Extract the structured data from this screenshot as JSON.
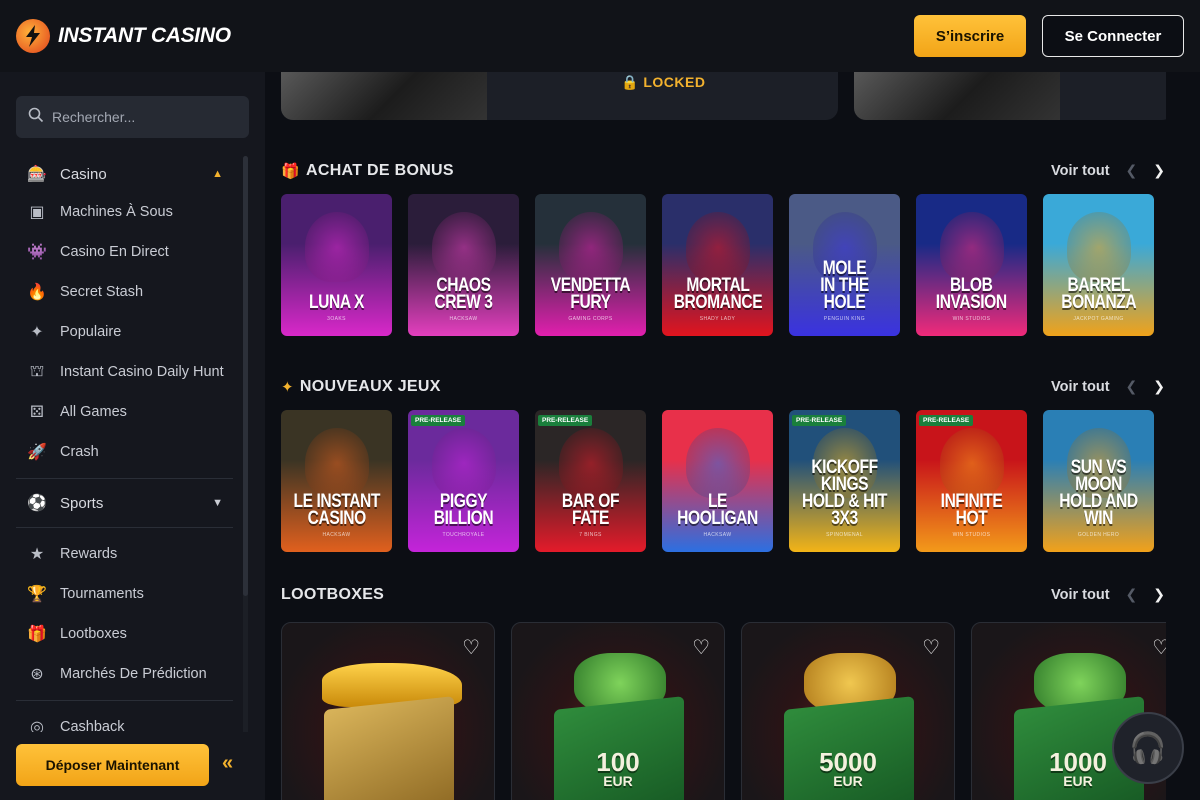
{
  "header": {
    "logo_text": "INSTANT CASINO",
    "signup_label": "S’inscrire",
    "login_label": "Se Connecter"
  },
  "sidebar": {
    "search_placeholder": "Rechercher...",
    "casino_label": "Casino",
    "items": [
      {
        "label": "Machines À Sous",
        "icon": "slot-machine-icon"
      },
      {
        "label": "Casino En Direct",
        "icon": "live-invader-icon"
      },
      {
        "label": "Secret Stash",
        "icon": "flame-icon"
      },
      {
        "label": "Populaire",
        "icon": "sparkle-icon"
      },
      {
        "label": "Instant Casino Daily Hunt",
        "icon": "daily-hunt-icon"
      },
      {
        "label": "All Games",
        "icon": "all-games-icon"
      },
      {
        "label": "Crash",
        "icon": "rocket-icon"
      }
    ],
    "sports_label": "Sports",
    "items2": [
      {
        "label": "Rewards",
        "icon": "star-icon"
      },
      {
        "label": "Tournaments",
        "icon": "trophy-icon"
      },
      {
        "label": "Lootboxes",
        "icon": "gift-icon"
      },
      {
        "label": "Marchés De Prédiction",
        "icon": "prediction-icon"
      }
    ],
    "partial_item": "Cashback",
    "deposit_label": "Déposer Maintenant"
  },
  "main": {
    "locked_label": "LOCKED",
    "sections": {
      "bonus": {
        "title": "ACHAT DE BONUS",
        "see_all": "Voir tout"
      },
      "new": {
        "title": "NOUVEAUX JEUX",
        "see_all": "Voir tout"
      },
      "loot": {
        "title": "LOOTBOXES",
        "see_all": "Voir tout"
      }
    },
    "bonus_games": [
      {
        "name": "LUNA X",
        "provider": "3OAKS",
        "colors": [
          "#4a1f6e",
          "#d928c9"
        ]
      },
      {
        "name": "CHAOS CREW 3",
        "provider": "HACKSAW",
        "colors": [
          "#2b1d3a",
          "#e43fbe"
        ]
      },
      {
        "name": "VENDETTA\nFURY",
        "provider": "GAMING CORPS",
        "colors": [
          "#25303a",
          "#e21fae"
        ]
      },
      {
        "name": "MORTAL\nBROMANCE",
        "provider": "SHADY LADY",
        "colors": [
          "#2a2f6a",
          "#e2141e"
        ]
      },
      {
        "name": "MOLE\nIN THE HOLE",
        "provider": "PENGUIN KING",
        "colors": [
          "#4b5a86",
          "#3a32e0"
        ]
      },
      {
        "name": "BLOB\nINVASION",
        "provider": "WIN STUDIOS",
        "colors": [
          "#182a86",
          "#f12a7a"
        ]
      },
      {
        "name": "BARREL\nBONANZA",
        "provider": "JACKPOT GAMING",
        "colors": [
          "#3aa9d8",
          "#f0a21a"
        ]
      }
    ],
    "new_games": [
      {
        "name": "LE INSTANT\nCASINO",
        "provider": "HACKSAW",
        "colors": [
          "#3a3424",
          "#e1601e"
        ],
        "badge": ""
      },
      {
        "name": "PIGGY BILLION",
        "provider": "TOUCHROYALE",
        "colors": [
          "#6b2a9c",
          "#c424d9"
        ],
        "badge": "PRE-RELEASE"
      },
      {
        "name": "BAR OF FATE",
        "provider": "7 BINGS",
        "colors": [
          "#2b2626",
          "#e41b2a"
        ],
        "badge": "PRE-RELEASE"
      },
      {
        "name": "LE HOOLIGAN",
        "provider": "HACKSAW",
        "colors": [
          "#e8304a",
          "#2c6fe1"
        ],
        "badge": ""
      },
      {
        "name": "KICKOFF KINGS\nHOLD & HIT 3X3",
        "provider": "SPINOMENAL",
        "colors": [
          "#21507a",
          "#f3b417"
        ],
        "badge": "PRE-RELEASE"
      },
      {
        "name": "INFINITE HOT",
        "provider": "WIN STUDIOS",
        "colors": [
          "#c8141a",
          "#f39a1a"
        ],
        "badge": "PRE-RELEASE"
      },
      {
        "name": "SUN VS MOON\nHOLD AND WIN",
        "provider": "GOLDEN HERO",
        "colors": [
          "#2a7fb5",
          "#f2a11a"
        ],
        "badge": ""
      }
    ],
    "lootboxes": [
      {
        "amount": "",
        "currency": "",
        "type": "car"
      },
      {
        "amount": "100",
        "currency": "EUR",
        "type": "cash"
      },
      {
        "amount": "5000",
        "currency": "EUR",
        "type": "gold"
      },
      {
        "amount": "1000",
        "currency": "EUR",
        "type": "cash"
      }
    ]
  },
  "colors": {
    "accent": "#f3b22e",
    "background": "#0c0e14",
    "sidebar": "#15171e"
  }
}
